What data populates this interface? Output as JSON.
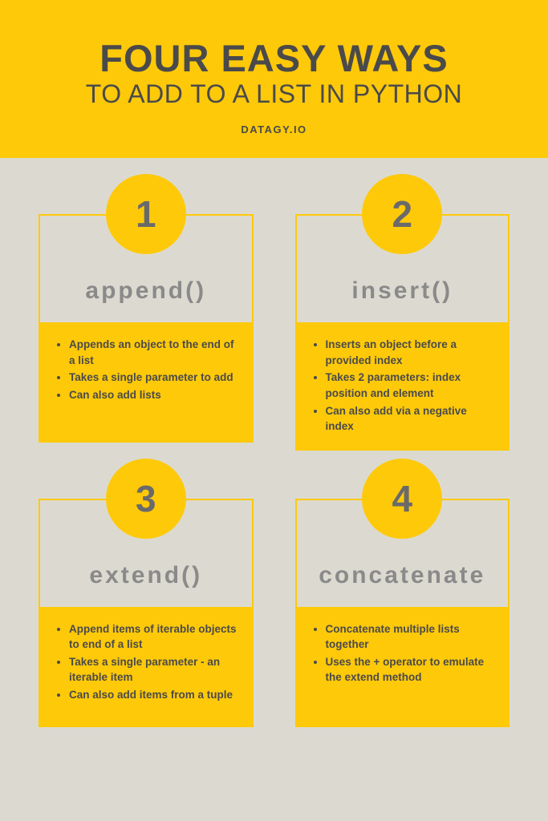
{
  "header": {
    "title_main": "FOUR EASY WAYS",
    "title_sub": "TO ADD TO A LIST IN PYTHON",
    "website": "DATAGY.IO"
  },
  "cards": [
    {
      "number": "1",
      "method": "append()",
      "points": [
        "Appends an object to the end of a list",
        "Takes a single parameter to add",
        "Can also add lists"
      ]
    },
    {
      "number": "2",
      "method": "insert()",
      "points": [
        "Inserts an object before a provided index",
        "Takes 2 parameters: index position and element",
        "Can also add via a negative index"
      ]
    },
    {
      "number": "3",
      "method": "extend()",
      "points": [
        "Append items of iterable objects to end of a list",
        "Takes a single parameter - an iterable item",
        "Can also add items from a tuple"
      ]
    },
    {
      "number": "4",
      "method": "concatenate",
      "points": [
        "Concatenate multiple lists together",
        "Uses the + operator to emulate the extend method"
      ]
    }
  ]
}
